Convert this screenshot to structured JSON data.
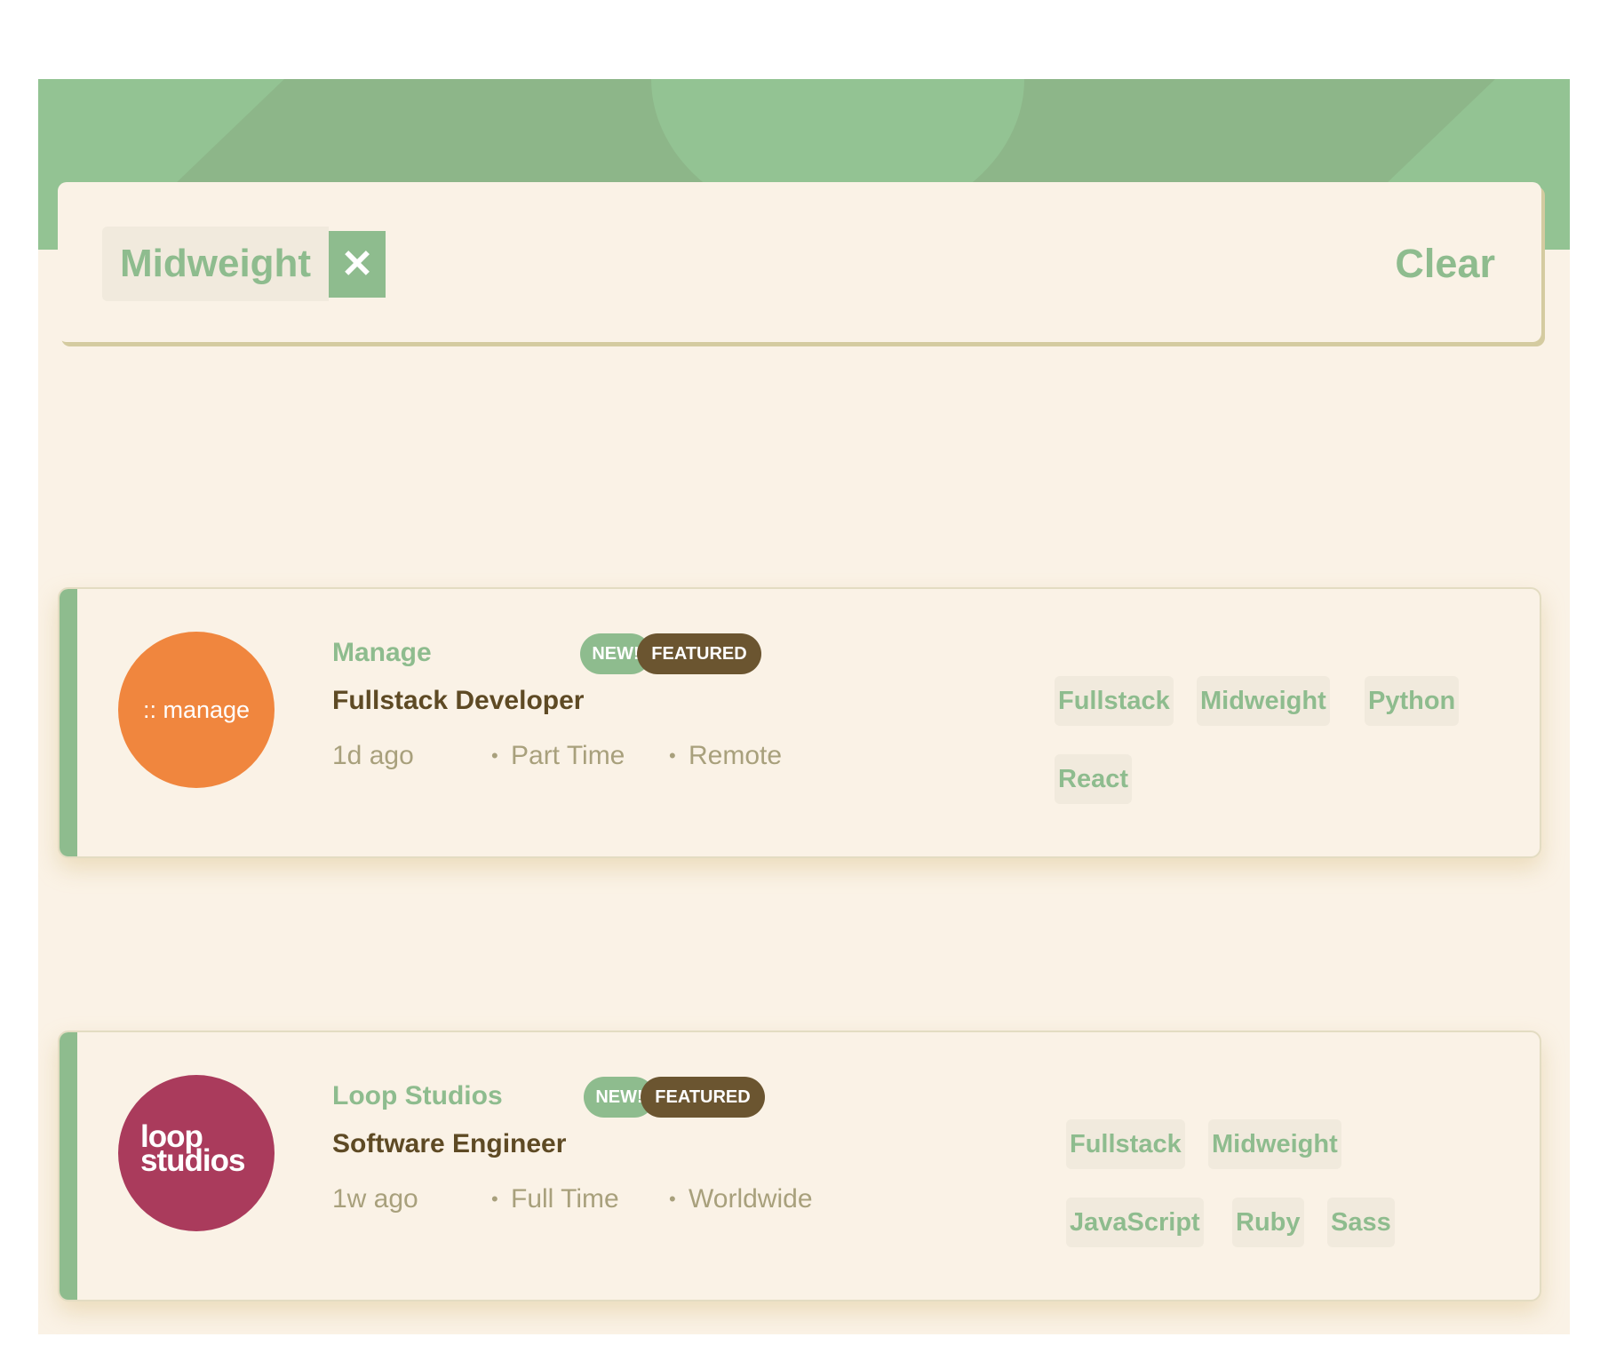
{
  "colors": {
    "primary": "#8ebc8e",
    "hero": "#93c393",
    "background": "#faf2e6",
    "tag_bg": "#f1eadd",
    "featured": "#6b5530",
    "title": "#5e4a24",
    "meta": "#a8a07c",
    "manage_logo": "#f0863e",
    "loop_logo": "#aa3b5c"
  },
  "filter_bar": {
    "chips": [
      {
        "label": "Midweight",
        "remove_icon": "close-icon",
        "remove_glyph": "✕"
      }
    ],
    "clear_label": "Clear"
  },
  "jobs": [
    {
      "logo_text": ":: manage",
      "company": "Manage",
      "badge_new": "NEW!",
      "badge_featured": "FEATURED",
      "position": "Fullstack Developer",
      "posted": "1d ago",
      "contract": "Part Time",
      "location": "Remote",
      "separator": "•",
      "tags": [
        "Fullstack",
        "Midweight",
        "Python",
        "React"
      ]
    },
    {
      "logo_text_line1": "loop",
      "logo_text_line2": "studios",
      "company": "Loop Studios",
      "badge_new": "NEW!",
      "badge_featured": "FEATURED",
      "position": "Software Engineer",
      "posted": "1w ago",
      "contract": "Full Time",
      "location": "Worldwide",
      "separator": "•",
      "tags": [
        "Fullstack",
        "Midweight",
        "JavaScript",
        "Ruby",
        "Sass"
      ]
    }
  ]
}
